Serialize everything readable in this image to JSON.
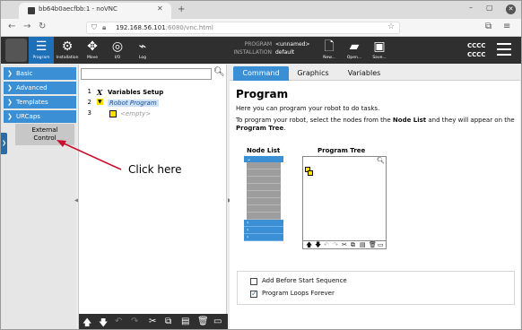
{
  "browser": {
    "tab_title": "bb64b0aecfbb:1 - noVNC",
    "new_tab": "+",
    "url_main": "192.168.56.101",
    "url_rest": ":6080/vnc.html"
  },
  "header": {
    "buttons": [
      {
        "label": "Program",
        "icon": "program-icon"
      },
      {
        "label": "Installation",
        "icon": "installation-icon"
      },
      {
        "label": "Move",
        "icon": "move-icon"
      },
      {
        "label": "I/O",
        "icon": "io-icon"
      },
      {
        "label": "Log",
        "icon": "log-icon"
      }
    ],
    "program_key": "PROGRAM",
    "program_value": "<unnamed>",
    "installation_key": "INSTALLATION",
    "installation_value": "default",
    "file_buttons": [
      {
        "label": "New...",
        "icon": "new-file-icon"
      },
      {
        "label": "Open...",
        "icon": "open-folder-icon"
      },
      {
        "label": "Save...",
        "icon": "save-icon"
      }
    ],
    "status_top": "CCCC",
    "status_bottom": "CCCC"
  },
  "sidebar": {
    "items": [
      {
        "label": "Basic"
      },
      {
        "label": "Advanced"
      },
      {
        "label": "Templates"
      },
      {
        "label": "URCaps"
      }
    ],
    "sub_item_line1": "External",
    "sub_item_line2": "Control"
  },
  "tree": {
    "lines": [
      {
        "num": "1",
        "icon": "X",
        "text": "Variables Setup"
      },
      {
        "num": "2",
        "icon": "▼",
        "text": "Robot Program"
      },
      {
        "num": "3",
        "icon": "",
        "text": "<empty>"
      }
    ]
  },
  "main": {
    "tabs": [
      "Command",
      "Graphics",
      "Variables"
    ],
    "title": "Program",
    "intro": "Here you can program your robot to do tasks.",
    "instr_pre": "To program your robot, select the nodes from the ",
    "instr_bold1": "Node List",
    "instr_mid": " and they will appear on the ",
    "instr_bold2": "Program Tree",
    "instr_end": ".",
    "node_list_label": "Node List",
    "program_tree_label": "Program Tree",
    "check1_label": "Add Before Start Sequence",
    "check1_checked": false,
    "check2_label": "Program Loops Forever",
    "check2_checked": true
  },
  "annotation": {
    "text": "Click here",
    "color": "#c8102e"
  }
}
